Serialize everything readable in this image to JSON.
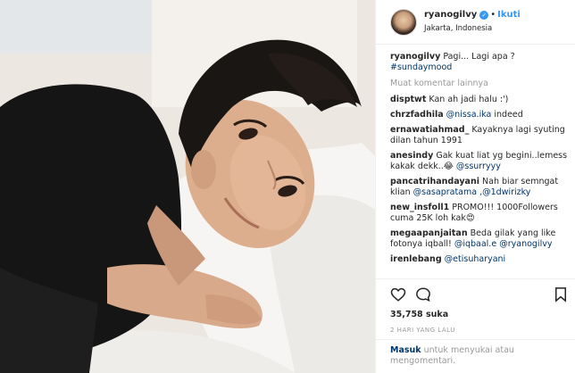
{
  "post": {
    "username": "ryanogilvy",
    "follow_label": "Ikuti",
    "separator": "•",
    "location": "Jakarta, Indonesia",
    "caption_user": "ryanogilvy",
    "caption_text": "Pagi... Lagi apa ?",
    "caption_tag": "#sundaymood",
    "load_more": "Muat komentar lainnya",
    "likes": "35,758 suka",
    "time_ago": "2 HARI YANG LALU",
    "login_link": "Masuk",
    "login_text": "untuk menyukai atau mengomentari."
  },
  "comments": [
    {
      "user": "disptwt",
      "text": "Kan ah jadi halu :')"
    },
    {
      "user": "chrzfadhila",
      "mention": "@nissa.ika",
      "text": " indeed"
    },
    {
      "user": "ernawatiahmad_",
      "text": "Kayaknya lagi syuting dilan tahun 1991"
    },
    {
      "user": "anesindy",
      "text": "Gak kuat liat yg begini..lemess kakak dekk..😂",
      "mention": "@ssurryyy"
    },
    {
      "user": "pancatrihandayani",
      "text": "Nah biar semngat klian",
      "mention": "@sasapratama",
      "extra": " ,@1dwirizky"
    },
    {
      "user": "new_insfoll1",
      "text": "PROMO!!! 1000Followers cuma 25K loh kak😍"
    },
    {
      "user": "megaapanjaitan",
      "text": "Beda gilak yang like fotonya iqball!",
      "mention": "@iqbaal.e",
      "extra": "@ryanogilvy"
    },
    {
      "user": "irenlebang",
      "mention": "@etisuharyani"
    }
  ],
  "icons": {
    "verified": "verified-badge-icon",
    "like": "heart-icon",
    "comment": "comment-bubble-icon",
    "save": "bookmark-icon"
  },
  "colors": {
    "link": "#003569",
    "follow": "#3897f0",
    "muted": "#999999",
    "border": "#efefef"
  }
}
